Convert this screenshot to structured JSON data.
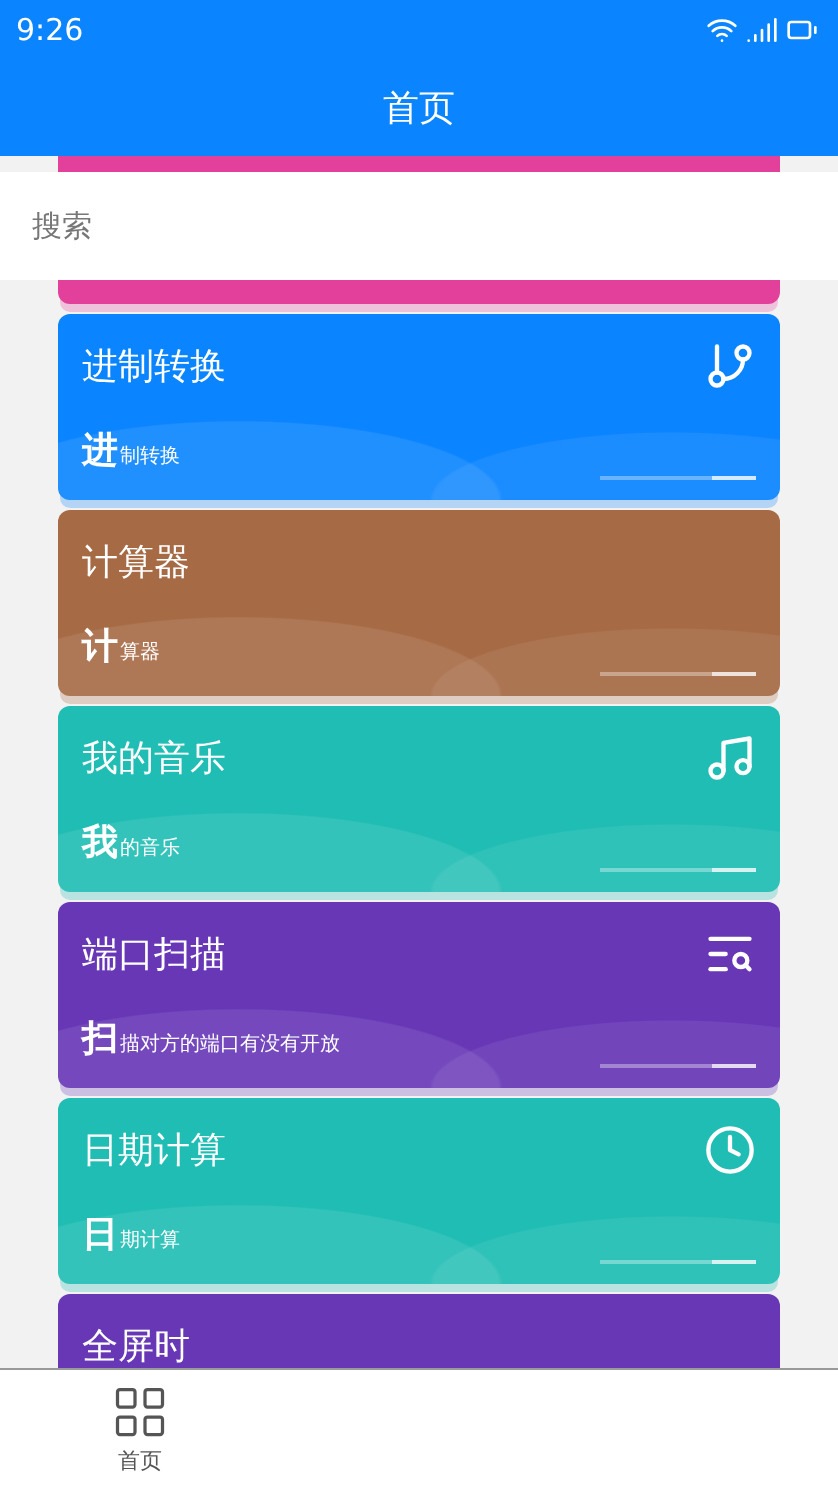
{
  "status_bar": {
    "time": "9:26"
  },
  "header": {
    "title": "首页"
  },
  "search": {
    "placeholder": "搜索"
  },
  "top_card": {
    "color": "#e2409a"
  },
  "cards": [
    {
      "title": "进制转换",
      "initial": "进",
      "rest": "制转换",
      "kind": "branch",
      "color": "#0a84ff"
    },
    {
      "title": "计算器",
      "initial": "计",
      "rest": "算器",
      "kind": "plain",
      "color": "#a66a45"
    },
    {
      "title": "我的音乐",
      "initial": "我",
      "rest": "的音乐",
      "kind": "music",
      "color": "#1fbdb3"
    },
    {
      "title": "端口扫描",
      "initial": "扫",
      "rest": "描对方的端口有没有开放",
      "kind": "scan",
      "color": "#6737b6"
    },
    {
      "title": "日期计算",
      "initial": "日",
      "rest": "期计算",
      "kind": "clock",
      "color": "#1fbdb3"
    },
    {
      "title": "全屏时",
      "kind": "partial",
      "color": "#6737b6"
    }
  ],
  "bottom_nav": [
    {
      "label": "首页",
      "selected": false
    }
  ]
}
